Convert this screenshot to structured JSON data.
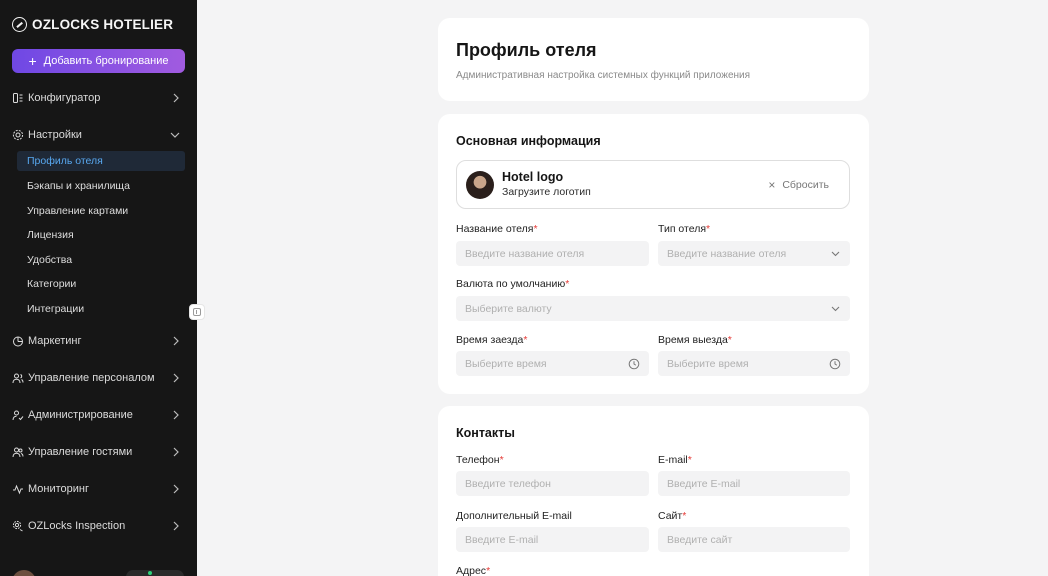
{
  "sidebar": {
    "brand": "OZLOCKS HOTELIER",
    "add_booking": "Добавить бронирование",
    "items": [
      {
        "label": "Конфигуратор"
      },
      {
        "label": "Настройки"
      },
      {
        "label": "Маркетинг"
      },
      {
        "label": "Управление персоналом"
      },
      {
        "label": "Администрирование"
      },
      {
        "label": "Управление гостями"
      },
      {
        "label": "Мониторинг"
      },
      {
        "label": "OZLocks Inspection"
      }
    ],
    "settings_sub": [
      {
        "label": "Профиль отеля",
        "active": true
      },
      {
        "label": "Бэкапы и хранилища"
      },
      {
        "label": "Управление картами"
      },
      {
        "label": "Лицензия"
      },
      {
        "label": "Удобства"
      },
      {
        "label": "Категории"
      },
      {
        "label": "Интеграции"
      }
    ]
  },
  "header": {
    "title": "Профиль отеля",
    "subtitle": "Административная настройка системных функций приложения"
  },
  "basic": {
    "title": "Основная информация",
    "logo_title": "Hotel logo",
    "logo_subtitle": "Загрузите логотип",
    "reset": "Сбросить",
    "hotel_name_label": "Название отеля",
    "hotel_name_placeholder": "Введите название отеля",
    "hotel_type_label": "Тип отеля",
    "hotel_type_placeholder": "Введите название отеля",
    "currency_label": "Валюта по умолчанию",
    "currency_placeholder": "Выберите валюту",
    "checkin_label": "Время заезда",
    "checkin_placeholder": "Выберите время",
    "checkout_label": "Время выезда",
    "checkout_placeholder": "Выберите время"
  },
  "contacts": {
    "title": "Контакты",
    "phone_label": "Телефон",
    "phone_placeholder": "Введите телефон",
    "email_label": "E-mail",
    "email_placeholder": "Введите E-mail",
    "extra_email_label": "Дополнительный E-mail",
    "extra_email_placeholder": "Введите E-mail",
    "site_label": "Сайт",
    "site_placeholder": "Введите сайт",
    "address_label": "Адрес"
  },
  "required_mark": "*"
}
